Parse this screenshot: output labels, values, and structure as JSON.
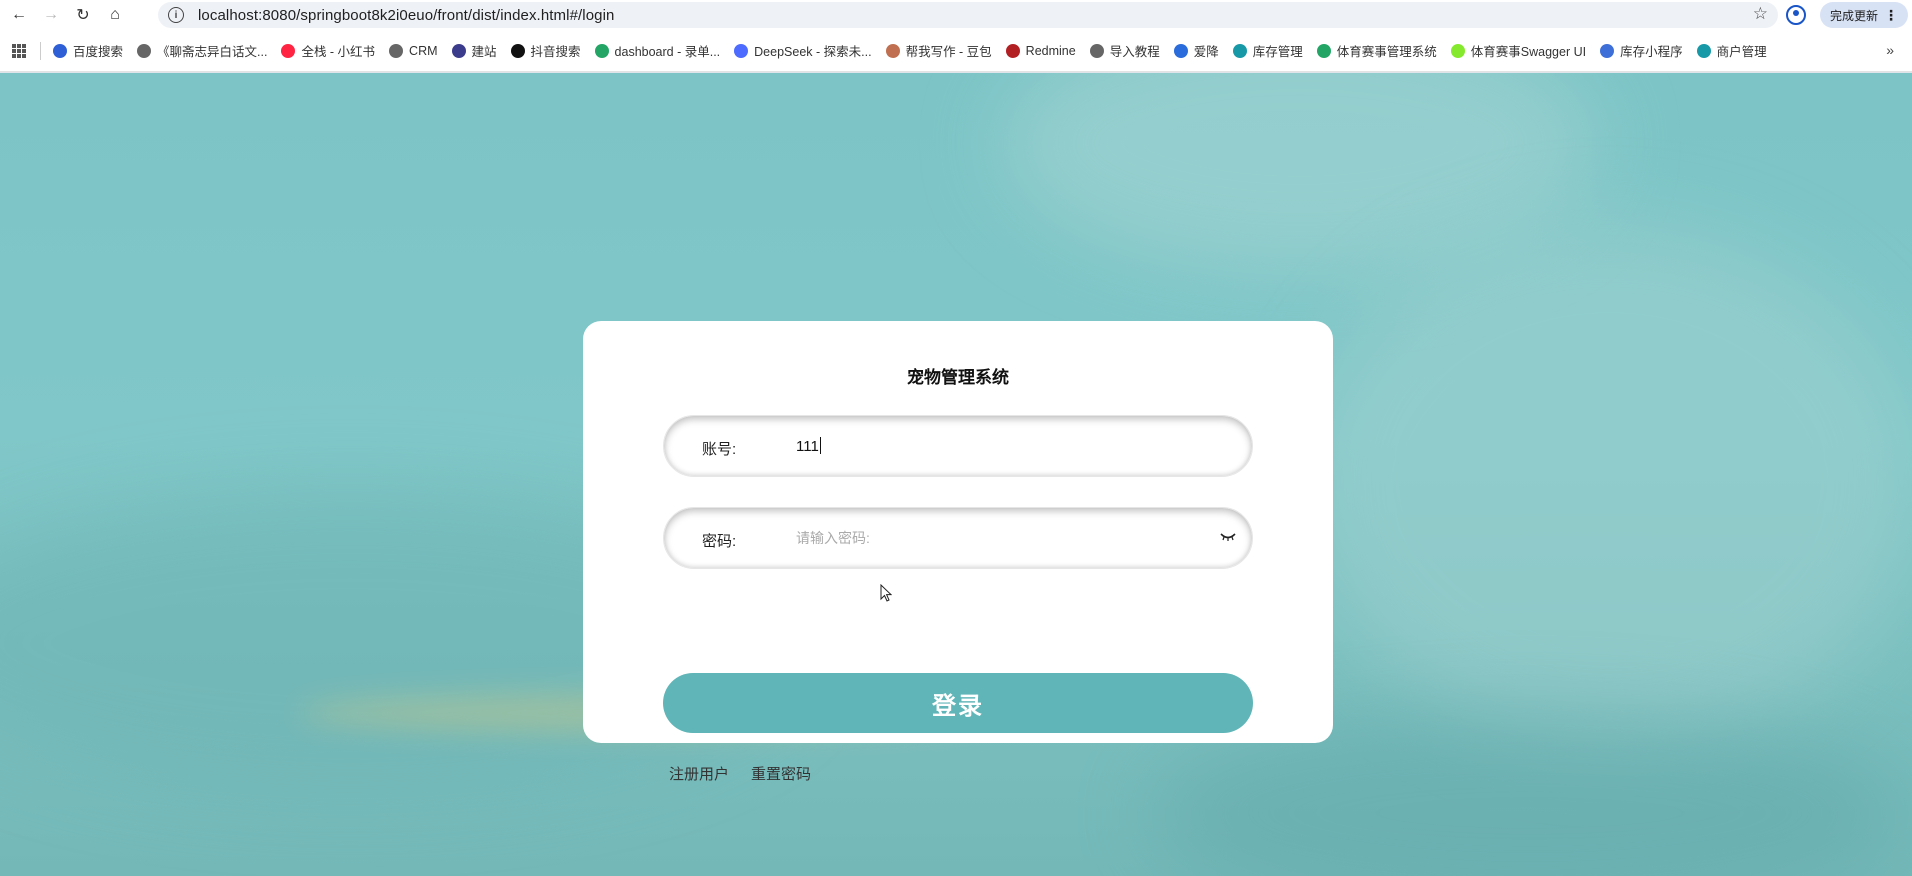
{
  "browser": {
    "url": "localhost:8080/springboot8k2i0euo/front/dist/index.html#/login",
    "update_label": "完成更新",
    "bookmarks": [
      {
        "label": "百度搜索",
        "color": "#2f5fd6"
      },
      {
        "label": "《聊斋志异白话文...",
        "color": "#666666"
      },
      {
        "label": "全栈 - 小红书",
        "color": "#ff2442"
      },
      {
        "label": "CRM",
        "color": "#666666"
      },
      {
        "label": "建站",
        "color": "#3c3c8c"
      },
      {
        "label": "抖音搜索",
        "color": "#111111"
      },
      {
        "label": "dashboard - 录单...",
        "color": "#23a566"
      },
      {
        "label": "DeepSeek - 探索未...",
        "color": "#4d6bfe"
      },
      {
        "label": "帮我写作 - 豆包",
        "color": "#c07050"
      },
      {
        "label": "Redmine",
        "color": "#b32024"
      },
      {
        "label": "导入教程",
        "color": "#666666"
      },
      {
        "label": "爱降",
        "color": "#2a6cdb"
      },
      {
        "label": "库存管理",
        "color": "#1899a8"
      },
      {
        "label": "体育赛事管理系统",
        "color": "#23a566"
      },
      {
        "label": "体育赛事Swagger UI",
        "color": "#85ea2d"
      },
      {
        "label": "库存小程序",
        "color": "#3e6fd8"
      },
      {
        "label": "商户管理",
        "color": "#1899a8"
      }
    ]
  },
  "login": {
    "title": "宠物管理系统",
    "account_label": "账号:",
    "account_value": "111",
    "password_label": "密码:",
    "password_placeholder": "请输入密码:",
    "login_label": "登录",
    "register_label": "注册用户",
    "reset_label": "重置密码"
  },
  "colors": {
    "background": "#7cc4c6",
    "accent": "#5fb5b7"
  }
}
